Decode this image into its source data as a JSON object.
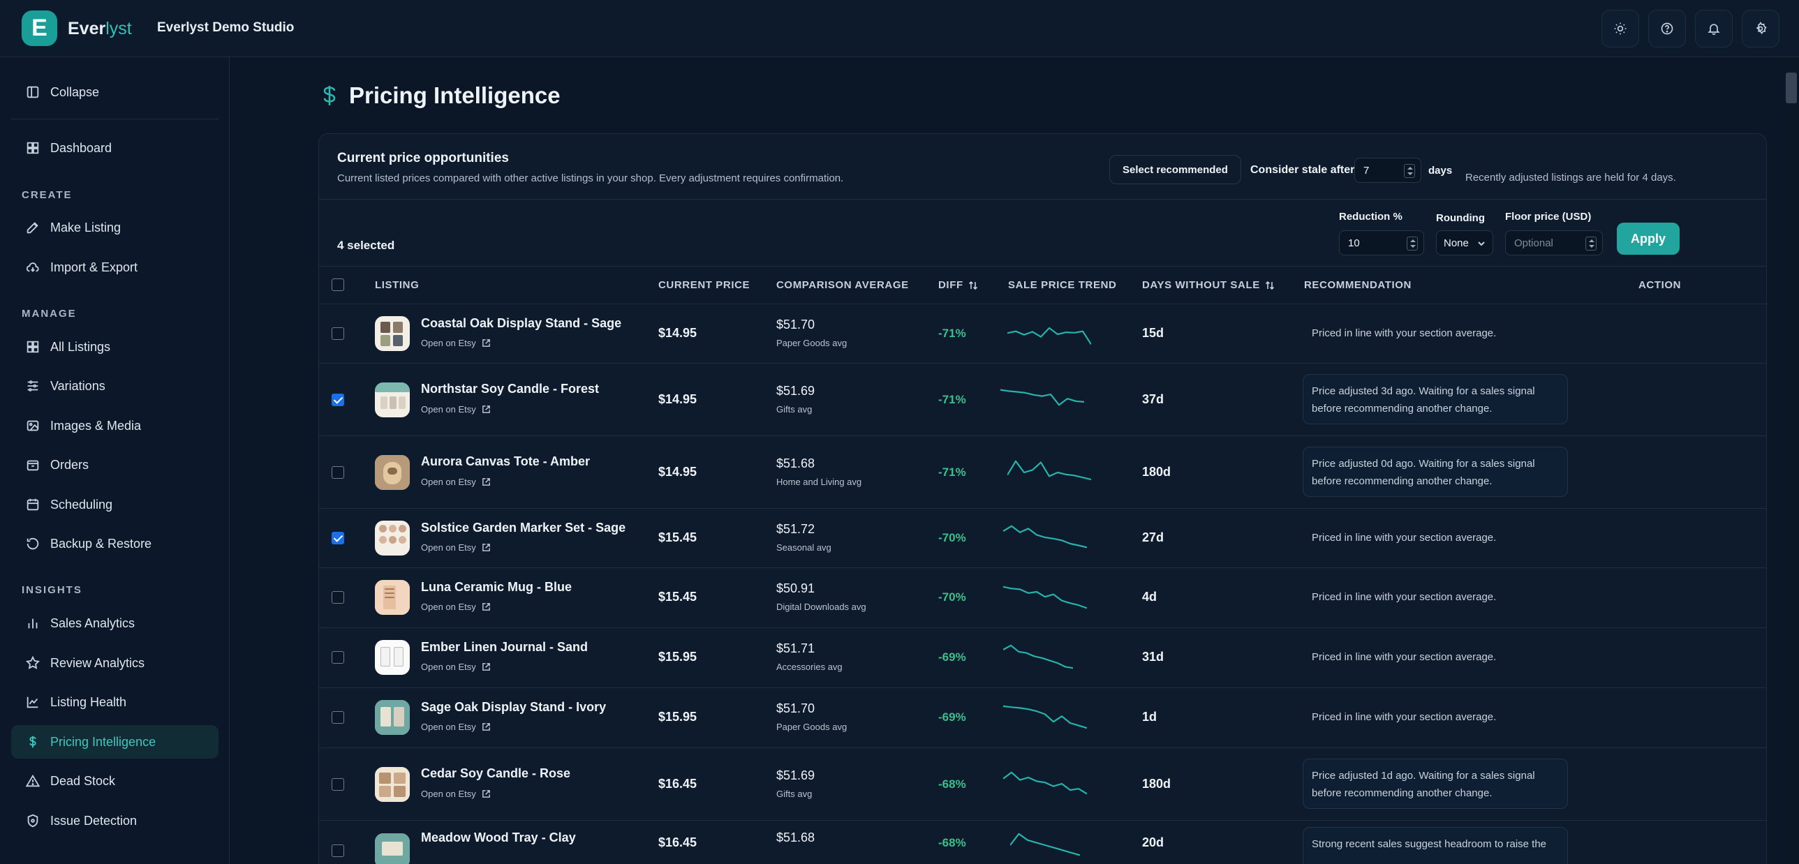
{
  "brand": {
    "initial": "E",
    "name_main": "Ever",
    "name_accent": "lyst",
    "studio": "Everlyst Demo Studio"
  },
  "colors": {
    "accent": "#22a59e",
    "positive_diff": "#3cbf8b",
    "background": "#0b1626",
    "checkbox_on": "#1d6fe8"
  },
  "topbar_icons": [
    "sun-icon",
    "help-icon",
    "bell-icon",
    "gear-icon"
  ],
  "sidebar": {
    "collapse": "Collapse",
    "dashboard": "Dashboard",
    "sections": {
      "create": "CREATE",
      "manage": "MANAGE",
      "insights": "INSIGHTS"
    },
    "create_items": [
      "Make Listing",
      "Import & Export"
    ],
    "manage_items": [
      "All Listings",
      "Variations",
      "Images & Media",
      "Orders",
      "Scheduling",
      "Backup & Restore"
    ],
    "insights_items": [
      "Sales Analytics",
      "Review Analytics",
      "Listing Health",
      "Pricing Intelligence",
      "Dead Stock",
      "Issue Detection"
    ],
    "active": "Pricing Intelligence"
  },
  "page": {
    "icon": "$",
    "title": "Pricing Intelligence"
  },
  "card": {
    "title": "Current price opportunities",
    "subtitle": "Current listed prices compared with other active listings in your shop. Every adjustment requires confirmation.",
    "select_recommended": "Select recommended",
    "stale_label": "Consider stale after",
    "stale_value": "7",
    "days_label": "days",
    "held_note": "Recently adjusted listings are held for 4 days.",
    "selected_count": "4 selected",
    "reduction_label": "Reduction %",
    "reduction_value": "10",
    "rounding_label": "Rounding",
    "rounding_value": "None",
    "floor_label": "Floor price (USD)",
    "floor_placeholder": "Optional",
    "apply": "Apply"
  },
  "table": {
    "headers": {
      "listing": "LISTING",
      "current_price": "CURRENT PRICE",
      "comparison_average": "COMPARISON AVERAGE",
      "diff": "DIFF",
      "trend": "SALE PRICE TREND",
      "days": "DAYS WITHOUT SALE",
      "recommendation": "RECOMMENDATION",
      "action": "ACTION"
    },
    "open_on_etsy": "Open on Etsy",
    "rows": [
      {
        "title": "Coastal Oak Display Stand - Sage",
        "price": "$14.95",
        "avg": "$51.70",
        "avg_sub": "Paper Goods avg",
        "diff": "-71%",
        "days": "15d",
        "recommendation": "Priced in line with your section average.",
        "boxed": false,
        "checked": false,
        "trend": [
          0.55,
          0.62,
          0.48,
          0.6,
          0.4,
          0.75,
          0.5,
          0.58,
          0.56,
          0.62,
          0.1
        ]
      },
      {
        "title": "Northstar Soy Candle - Forest",
        "price": "$14.95",
        "avg": "$51.69",
        "avg_sub": "Gifts avg",
        "diff": "-71%",
        "days": "37d",
        "recommendation": "Price adjusted 3d ago. Waiting for a sales signal before recommending another change.",
        "boxed": true,
        "checked": true,
        "trend": [
          0.9,
          0.85,
          0.82,
          0.78,
          0.7,
          0.65,
          0.72,
          0.3,
          0.55,
          0.45,
          0.42
        ]
      },
      {
        "title": "Aurora Canvas Tote - Amber",
        "price": "$14.95",
        "avg": "$51.68",
        "avg_sub": "Home and Living avg",
        "diff": "-71%",
        "days": "180d",
        "recommendation": "Price adjusted 0d ago. Waiting for a sales signal before recommending another change.",
        "boxed": true,
        "checked": false,
        "trend": [
          0.4,
          0.95,
          0.5,
          0.6,
          0.9,
          0.35,
          0.5,
          0.42,
          0.38,
          0.3,
          0.22
        ]
      },
      {
        "title": "Solstice Garden Marker Set - Sage",
        "price": "$15.45",
        "avg": "$51.72",
        "avg_sub": "Seasonal avg",
        "diff": "-70%",
        "days": "27d",
        "recommendation": "Priced in line with your section average.",
        "boxed": false,
        "checked": true,
        "trend": [
          0.75,
          0.95,
          0.7,
          0.85,
          0.6,
          0.5,
          0.45,
          0.38,
          0.25,
          0.18,
          0.1
        ]
      },
      {
        "title": "Luna Ceramic Mug - Blue",
        "price": "$15.45",
        "avg": "$50.91",
        "avg_sub": "Digital Downloads avg",
        "diff": "-70%",
        "days": "4d",
        "recommendation": "Priced in line with your section average.",
        "boxed": false,
        "checked": false,
        "trend": [
          0.95,
          0.88,
          0.85,
          0.7,
          0.75,
          0.55,
          0.65,
          0.4,
          0.3,
          0.22,
          0.1
        ]
      },
      {
        "title": "Ember Linen Journal - Sand",
        "price": "$15.95",
        "avg": "$51.71",
        "avg_sub": "Accessories avg",
        "diff": "-69%",
        "days": "31d",
        "recommendation": "Priced in line with your section average.",
        "boxed": false,
        "checked": false,
        "trend": [
          0.78,
          0.95,
          0.7,
          0.65,
          0.52,
          0.45,
          0.35,
          0.25,
          0.1,
          0.05
        ]
      },
      {
        "title": "Sage Oak Display Stand - Ivory",
        "price": "$15.95",
        "avg": "$51.70",
        "avg_sub": "Paper Goods avg",
        "diff": "-69%",
        "days": "1d",
        "recommendation": "Priced in line with your section average.",
        "boxed": false,
        "checked": false,
        "trend": [
          0.92,
          0.88,
          0.85,
          0.8,
          0.72,
          0.6,
          0.3,
          0.52,
          0.25,
          0.15,
          0.05
        ]
      },
      {
        "title": "Cedar Soy Candle - Rose",
        "price": "$16.45",
        "avg": "$51.69",
        "avg_sub": "Gifts avg",
        "diff": "-68%",
        "days": "180d",
        "recommendation": "Price adjusted 1d ago. Waiting for a sales signal before recommending another change.",
        "boxed": true,
        "checked": false,
        "trend": [
          0.7,
          0.95,
          0.65,
          0.75,
          0.6,
          0.55,
          0.4,
          0.5,
          0.25,
          0.3,
          0.1
        ]
      },
      {
        "title": "Meadow Wood Tray - Clay",
        "price": "$16.45",
        "avg": "$51.68",
        "avg_sub": "",
        "diff": "-68%",
        "days": "20d",
        "recommendation": "Strong recent sales suggest headroom to raise the",
        "boxed": true,
        "checked": false,
        "trend": [
          0.5,
          0.95,
          0.7,
          0.6,
          0.5,
          0.4,
          0.3,
          0.2,
          0.1
        ]
      }
    ]
  }
}
